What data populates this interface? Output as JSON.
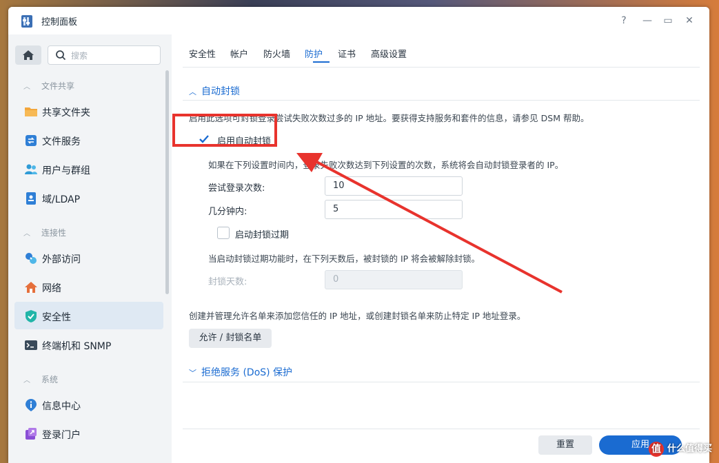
{
  "window": {
    "title": "控制面板"
  },
  "titlebar_buttons": {
    "help": "?",
    "minimize": "—",
    "maximize": "▭",
    "close": "✕"
  },
  "sidebar": {
    "search_placeholder": "搜索",
    "sections": [
      {
        "label": "文件共享",
        "items": [
          {
            "label": "共享文件夹",
            "icon": "folder-icon"
          },
          {
            "label": "文件服务",
            "icon": "file-services-icon"
          },
          {
            "label": "用户与群组",
            "icon": "users-icon"
          },
          {
            "label": "域/LDAP",
            "icon": "domain-icon"
          }
        ]
      },
      {
        "label": "连接性",
        "items": [
          {
            "label": "外部访问",
            "icon": "external-access-icon"
          },
          {
            "label": "网络",
            "icon": "network-icon"
          },
          {
            "label": "安全性",
            "icon": "security-shield-icon",
            "active": true
          },
          {
            "label": "终端机和 SNMP",
            "icon": "terminal-icon"
          }
        ]
      },
      {
        "label": "系统",
        "items": [
          {
            "label": "信息中心",
            "icon": "info-icon"
          },
          {
            "label": "登录门户",
            "icon": "login-portal-icon"
          }
        ]
      }
    ]
  },
  "tabs": [
    "安全性",
    "帐户",
    "防火墙",
    "防护",
    "证书",
    "高级设置"
  ],
  "active_tab": "防护",
  "auto_block": {
    "header": "自动封锁",
    "description": "启用此选项可封锁登录尝试失败次数过多的 IP 地址。要获得支持服务和套件的信息，请参见 DSM 帮助。",
    "enable_label": "启用自动封锁",
    "enable_checked": true,
    "rule_text": "如果在下列设置时间内，登录失败次数达到下列设置的次数，系统将会自动封锁登录者的 IP。",
    "attempts_label": "尝试登录次数:",
    "attempts_value": "10",
    "minutes_label": "几分钟内:",
    "minutes_value": "5",
    "expire_label": "启动封锁过期",
    "expire_checked": false,
    "expire_text": "当启动封锁过期功能时，在下列天数后，被封锁的 IP 将会被解除封锁。",
    "days_label": "封锁天数:",
    "days_value": "0",
    "allowlist_text": "创建并管理允许名单来添加您信任的 IP 地址，或创建封锁名单来防止特定 IP 地址登录。",
    "allowlist_button": "允许 / 封锁名单"
  },
  "dos": {
    "header": "拒绝服务 (DoS) 保护"
  },
  "footer": {
    "reset": "重置",
    "apply": "应用"
  },
  "watermark": {
    "badge": "值",
    "text": "什么值得买"
  },
  "colors": {
    "accent": "#1a6bd1",
    "annotation": "#e8332d",
    "active_bg": "#dfe9f3"
  }
}
